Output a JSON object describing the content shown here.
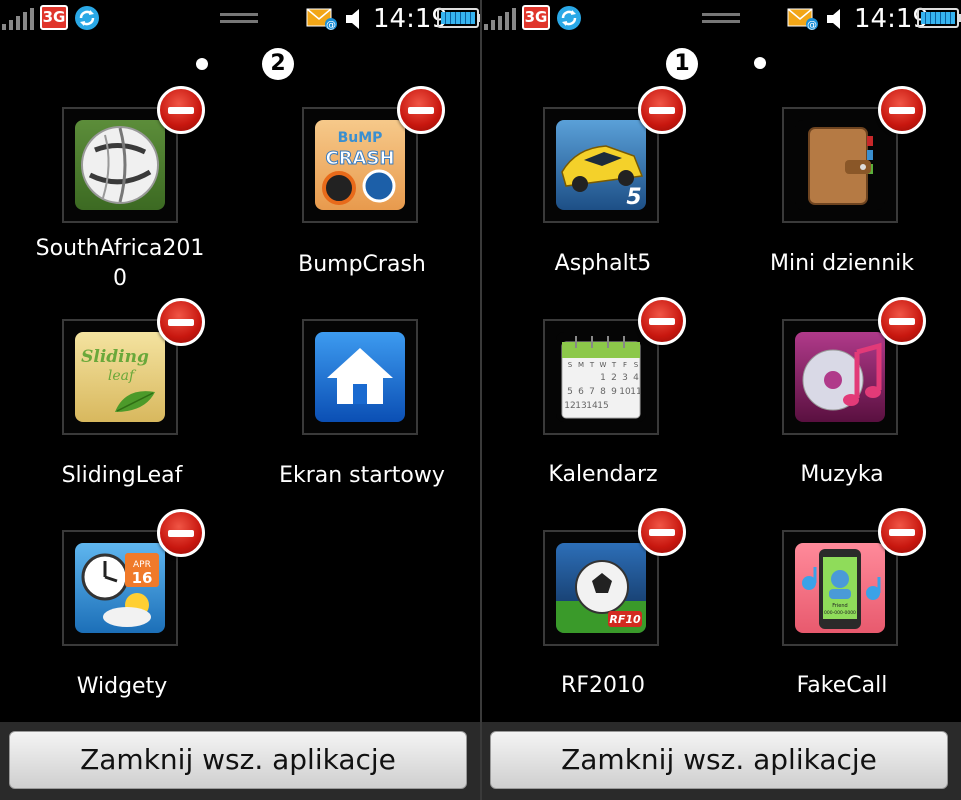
{
  "status_bar": {
    "network": "3G",
    "time": "14:19"
  },
  "left_screen": {
    "page_indicator": "2",
    "apps": [
      {
        "label": "SouthAfrica2010",
        "label_line1": "SouthAfrica201",
        "label_line2": "0",
        "icon": "soccer-ball-icon",
        "removable": true
      },
      {
        "label": "BumpCrash",
        "icon": "bumpcrash-game-icon",
        "removable": true
      },
      {
        "label": "SlidingLeaf",
        "icon": "sliding-leaf-icon",
        "removable": true
      },
      {
        "label": "Ekran startowy",
        "icon": "home-icon",
        "removable": false
      },
      {
        "label": "Widgety",
        "icon": "widgets-clock-weather-icon",
        "removable": true
      }
    ],
    "bottom_button": "Zamknij wsz. aplikacje"
  },
  "right_screen": {
    "page_indicator": "1",
    "apps": [
      {
        "label": "Asphalt5",
        "icon": "racing-car-icon",
        "removable": true
      },
      {
        "label": "Mini dziennik",
        "icon": "diary-icon",
        "removable": true
      },
      {
        "label": "Kalendarz",
        "icon": "calendar-icon",
        "removable": true
      },
      {
        "label": "Muzyka",
        "icon": "music-icon",
        "removable": true
      },
      {
        "label": "RF2010",
        "icon": "soccer-game-icon",
        "removable": true
      },
      {
        "label": "FakeCall",
        "icon": "fake-call-phone-icon",
        "removable": true
      }
    ],
    "bottom_button": "Zamknij wsz. aplikacje"
  },
  "icon_texts": {
    "bump_line1": "BuMP",
    "bump_line2": "CRASH",
    "sliding_line1": "Sliding",
    "sliding_line2": "leaf",
    "widget_month": "APR",
    "widget_day": "16",
    "rf_badge": "RF10",
    "asphalt_num": "5",
    "fakecall_name": "Friend",
    "fakecall_number": "000-000-0000",
    "calendar_days": [
      "S",
      "M",
      "T",
      "W",
      "T",
      "F",
      "S"
    ],
    "calendar_nums": [
      "1",
      "2",
      "3",
      "4",
      "5",
      "6",
      "7",
      "8",
      "9",
      "10",
      "11",
      "12",
      "13",
      "14",
      "15"
    ]
  },
  "colors": {
    "delete_badge": "#d0201a",
    "status_3g": "#e0352b",
    "battery": "#36b4f0",
    "button_bg": "#e6e6e6"
  }
}
